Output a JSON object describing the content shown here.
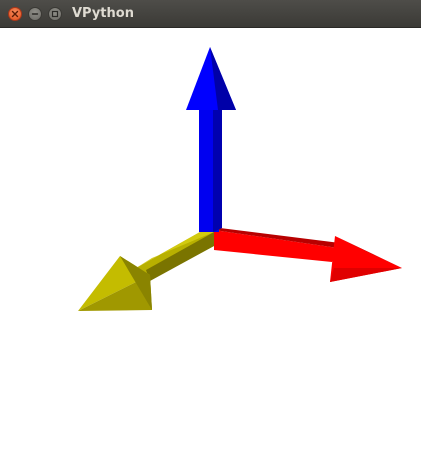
{
  "window": {
    "title": "VPython"
  },
  "titlebar_buttons": [
    {
      "name": "close-button",
      "icon": "close-icon",
      "color": "#e95420"
    },
    {
      "name": "minimize-button",
      "icon": "minimize-icon",
      "color": "#7a7974"
    },
    {
      "name": "maximize-button",
      "icon": "maximize-icon",
      "color": "#7a7974"
    }
  ],
  "scene": {
    "background": "#ffffff",
    "arrows": [
      {
        "name": "y-axis-arrow",
        "color": "#0000ff",
        "direction": "up"
      },
      {
        "name": "x-axis-arrow",
        "color": "#ff0000",
        "direction": "right"
      },
      {
        "name": "z-axis-arrow",
        "color": "#c8c000",
        "direction": "toward-viewer-left"
      }
    ]
  }
}
